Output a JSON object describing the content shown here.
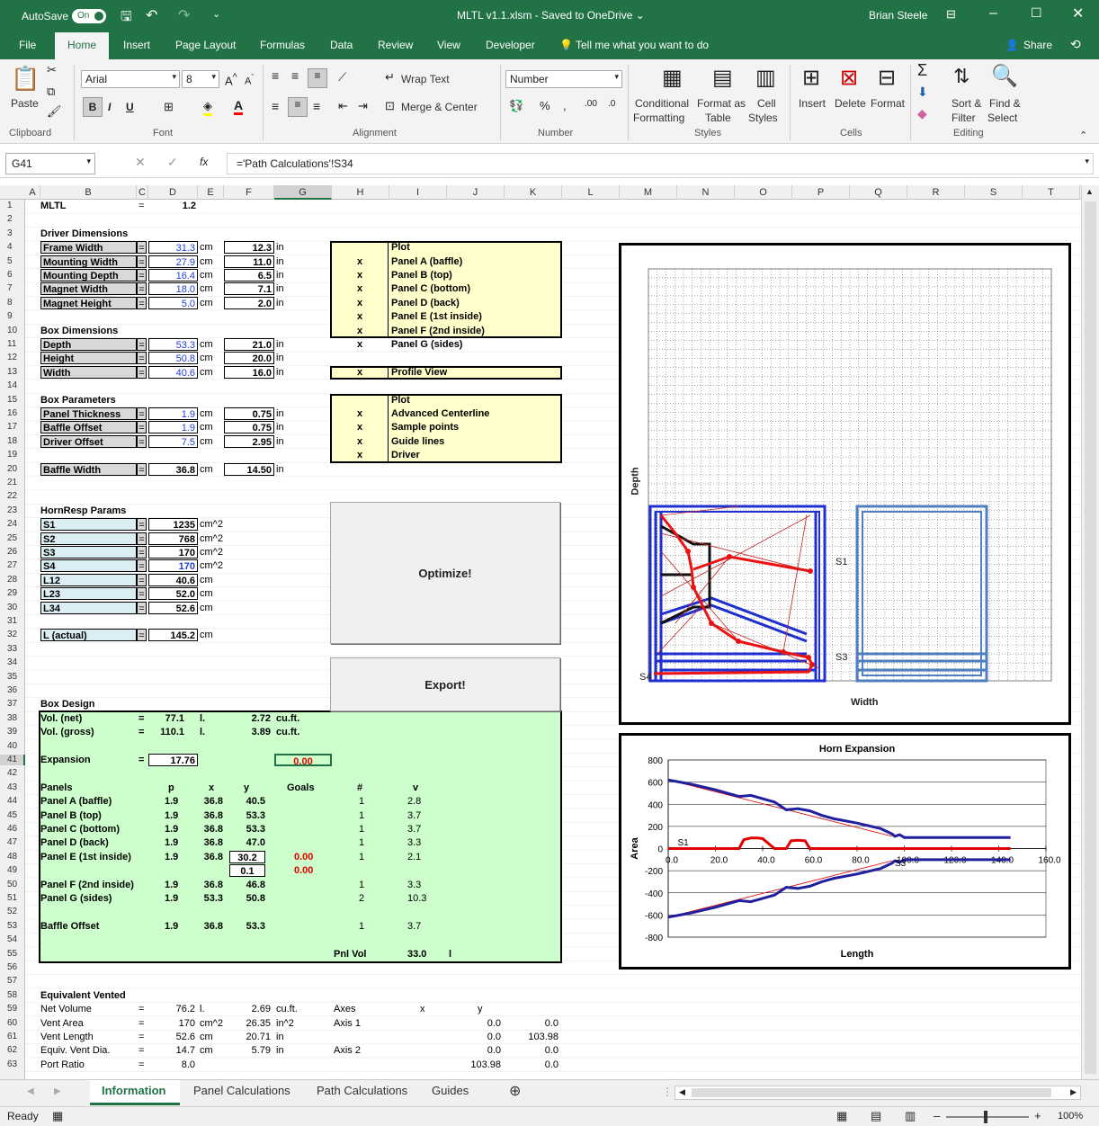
{
  "window": {
    "autosave": "AutoSave",
    "autosave_state": "On",
    "title": "MLTL v1.1.xlsm  -  Saved to OneDrive  ⌄",
    "user": "Brian Steele"
  },
  "ribbon_tabs": [
    "File",
    "Home",
    "Insert",
    "Page Layout",
    "Formulas",
    "Data",
    "Review",
    "View",
    "Developer",
    "Tell me what you want to do",
    "Share"
  ],
  "ribbon": {
    "paste": "Paste",
    "font_name": "Arial",
    "font_size": "8",
    "wrap_text": "Wrap Text",
    "merge_center": "Merge & Center",
    "number_format": "Number",
    "conditional": "Conditional",
    "formatting": "Formatting",
    "format_as": "Format as",
    "table": "Table",
    "cell": "Cell",
    "styles_lbl": "Styles",
    "insert": "Insert",
    "delete": "Delete",
    "format": "Format",
    "sort": "Sort &",
    "filter": "Filter",
    "find": "Find &",
    "select": "Select",
    "groups": [
      "Clipboard",
      "Font",
      "Alignment",
      "Number",
      "Styles",
      "Cells",
      "Editing"
    ]
  },
  "formula_bar": {
    "name_box": "G41",
    "fx": "fx",
    "formula": "='Path Calculations'!S34"
  },
  "columns": [
    "A",
    "B",
    "C",
    "D",
    "E",
    "F",
    "G",
    "H",
    "I",
    "J",
    "K",
    "L",
    "M",
    "N",
    "O",
    "P",
    "Q",
    "R",
    "S",
    "T"
  ],
  "rows": [
    "1",
    "2",
    "3",
    "4",
    "5",
    "6",
    "7",
    "8",
    "9",
    "10",
    "11",
    "12",
    "13",
    "14",
    "15",
    "16",
    "17",
    "18",
    "19",
    "20",
    "21",
    "22",
    "23",
    "24",
    "25",
    "26",
    "27",
    "28",
    "29",
    "30",
    "31",
    "32",
    "33",
    "34",
    "35",
    "36",
    "37",
    "38",
    "39",
    "40",
    "41",
    "42",
    "43",
    "44",
    "45",
    "46",
    "47",
    "48",
    "49",
    "50",
    "51",
    "52",
    "53",
    "54",
    "55",
    "56",
    "57",
    "58",
    "59",
    "60",
    "61",
    "62",
    "63"
  ],
  "sheet": {
    "title": "MLTL",
    "title_eq": "=",
    "version": "1.2",
    "driver_hdr": "Driver Dimensions",
    "driver": [
      {
        "label": "Frame Width",
        "cm": "31.3",
        "in": "12.3"
      },
      {
        "label": "Mounting Width",
        "cm": "27.9",
        "in": "11.0"
      },
      {
        "label": "Mounting Depth",
        "cm": "16.4",
        "in": "6.5"
      },
      {
        "label": "Magnet Width",
        "cm": "18.0",
        "in": "7.1"
      },
      {
        "label": "Magnet Height",
        "cm": "5.0",
        "in": "2.0"
      }
    ],
    "box_hdr": "Box Dimensions",
    "box": [
      {
        "label": "Depth",
        "cm": "53.3",
        "in": "21.0"
      },
      {
        "label": "Height",
        "cm": "50.8",
        "in": "20.0"
      },
      {
        "label": "Width",
        "cm": "40.6",
        "in": "16.0"
      }
    ],
    "params_hdr": "Box Parameters",
    "params": [
      {
        "label": "Panel Thickness",
        "cm": "1.9",
        "in": "0.75"
      },
      {
        "label": "Baffle Offset",
        "cm": "1.9",
        "in": "0.75"
      },
      {
        "label": "Driver Offset",
        "cm": "7.5",
        "in": "2.95"
      }
    ],
    "baffle": {
      "label": "Baffle Width",
      "cm": "36.8",
      "in": "14.50"
    },
    "unit_cm": "cm",
    "unit_in": "in",
    "eq": "=",
    "hornresp_hdr": "HornResp Params",
    "hornresp": [
      {
        "label": "S1",
        "val": "1235",
        "unit": "cm^2"
      },
      {
        "label": "S2",
        "val": "768",
        "unit": "cm^2"
      },
      {
        "label": "S3",
        "val": "170",
        "unit": "cm^2"
      },
      {
        "label": "S4",
        "val": "170",
        "unit": "cm^2"
      },
      {
        "label": "L12",
        "val": "40.6",
        "unit": "cm"
      },
      {
        "label": "L23",
        "val": "52.0",
        "unit": "cm"
      },
      {
        "label": "L34",
        "val": "52.6",
        "unit": "cm"
      }
    ],
    "lactual": {
      "label": "L (actual)",
      "val": "145.2",
      "unit": "cm"
    },
    "plot1": {
      "hdr": "Plot",
      "items": [
        {
          "x": "x",
          "label": "Panel A (baffle)"
        },
        {
          "x": "x",
          "label": "Panel B (top)"
        },
        {
          "x": "x",
          "label": "Panel C (bottom)"
        },
        {
          "x": "x",
          "label": "Panel D (back)"
        },
        {
          "x": "x",
          "label": "Panel E (1st inside)"
        },
        {
          "x": "x",
          "label": "Panel F (2nd inside)"
        },
        {
          "x": "x",
          "label": "Panel G (sides)"
        }
      ]
    },
    "profile": {
      "x": "x",
      "label": "Profile View"
    },
    "plot2": {
      "hdr": "Plot",
      "items": [
        {
          "x": "x",
          "label": "Advanced Centerline"
        },
        {
          "x": "x",
          "label": "Sample points"
        },
        {
          "x": "x",
          "label": "Guide lines"
        },
        {
          "x": "x",
          "label": "Driver"
        }
      ]
    },
    "optimize": "Optimize!",
    "export": "Export!",
    "design_hdr": "Box Design",
    "vol_net": {
      "label": "Vol. (net)",
      "eq": "=",
      "l": "77.1",
      "lu": "l.",
      "cf": "2.72",
      "cfu": "cu.ft."
    },
    "vol_gross": {
      "label": "Vol. (gross)",
      "eq": "=",
      "l": "110.1",
      "lu": "l.",
      "cf": "3.89",
      "cfu": "cu.ft."
    },
    "expansion": {
      "label": "Expansion",
      "eq": "=",
      "val": "17.76",
      "goal": "0.00"
    },
    "panel_cols": {
      "name": "Panels",
      "p": "p",
      "x": "x",
      "y": "y",
      "goals": "Goals",
      "n": "#",
      "v": "v"
    },
    "panels": [
      {
        "name": "Panel A (baffle)",
        "p": "1.9",
        "x": "36.8",
        "y": "40.5",
        "g": "",
        "n": "1",
        "v": "2.8"
      },
      {
        "name": "Panel B (top)",
        "p": "1.9",
        "x": "36.8",
        "y": "53.3",
        "g": "",
        "n": "1",
        "v": "3.7"
      },
      {
        "name": "Panel C (bottom)",
        "p": "1.9",
        "x": "36.8",
        "y": "53.3",
        "g": "",
        "n": "1",
        "v": "3.7"
      },
      {
        "name": "Panel D (back)",
        "p": "1.9",
        "x": "36.8",
        "y": "47.0",
        "g": "",
        "n": "1",
        "v": "3.3"
      },
      {
        "name": "Panel E (1st inside)",
        "p": "1.9",
        "x": "36.8",
        "y": "30.2",
        "g": "0.00",
        "n": "1",
        "v": "2.1"
      }
    ],
    "panel_e2": {
      "y": "0.1",
      "g": "0.00"
    },
    "panels2": [
      {
        "name": "Panel F (2nd inside)",
        "p": "1.9",
        "x": "36.8",
        "y": "46.8",
        "n": "1",
        "v": "3.3"
      },
      {
        "name": "Panel G (sides)",
        "p": "1.9",
        "x": "53.3",
        "y": "50.8",
        "n": "2",
        "v": "10.3"
      }
    ],
    "baffle_offset": {
      "name": "Baffle Offset",
      "p": "1.9",
      "x": "36.8",
      "y": "53.3",
      "n": "1",
      "v": "3.7"
    },
    "pnlvol": {
      "label": "Pnl Vol",
      "val": "33.0",
      "unit": "l"
    },
    "vented_hdr": "Equivalent Vented",
    "vented": [
      {
        "label": "Net Volume",
        "eq": "=",
        "a": "76.2",
        "au": "l.",
        "b": "2.69",
        "bu": "cu.ft."
      },
      {
        "label": "Vent Area",
        "eq": "=",
        "a": "170",
        "au": "cm^2",
        "b": "26.35",
        "bu": "in^2"
      },
      {
        "label": "Vent Length",
        "eq": "=",
        "a": "52.6",
        "au": "cm",
        "b": "20.71",
        "bu": "in"
      },
      {
        "label": "Equiv. Vent Dia.",
        "eq": "=",
        "a": "14.7",
        "au": "cm",
        "b": "5.79",
        "bu": "in"
      },
      {
        "label": "Port Ratio",
        "eq": "=",
        "a": "8.0",
        "au": "",
        "b": "",
        "bu": ""
      }
    ],
    "axes": {
      "hdr": "Axes",
      "x": "x",
      "y": "y",
      "rows": [
        {
          "name": "Axis 1",
          "x": "0.0",
          "y": "0.0"
        },
        {
          "name": "",
          "x": "0.0",
          "y": "103.98"
        },
        {
          "name": "Axis 2",
          "x": "0.0",
          "y": "0.0"
        },
        {
          "name": "",
          "x": "103.98",
          "y": "0.0"
        }
      ]
    }
  },
  "profile_chart": {
    "xlabel": "Width",
    "ylabel": "Depth",
    "s1": "S1",
    "s3": "S3",
    "s4": "S4"
  },
  "chart_data": {
    "type": "line",
    "title": "Horn Expansion",
    "xlabel": "Length",
    "ylabel": "Area",
    "xlim": [
      0,
      160
    ],
    "ylim": [
      -800,
      800
    ],
    "xticks": [
      "0.0",
      "20.0",
      "40.0",
      "60.0",
      "80.0",
      "100.0",
      "120.0",
      "140.0",
      "160.0"
    ],
    "yticks": [
      "800",
      "600",
      "400",
      "200",
      "0",
      "-200",
      "-400",
      "-600",
      "-800"
    ],
    "annotations": [
      "S1",
      "S3"
    ],
    "series": [
      {
        "color": "#1f1fa0",
        "x": [
          0,
          10,
          20,
          30,
          35,
          40,
          45,
          50,
          55,
          60,
          65,
          70,
          80,
          90,
          95,
          96,
          98,
          100,
          110,
          120,
          130,
          145
        ],
        "y": [
          620,
          580,
          530,
          470,
          480,
          450,
          420,
          350,
          360,
          340,
          300,
          270,
          230,
          180,
          130,
          110,
          125,
          100,
          100,
          100,
          100,
          100
        ]
      },
      {
        "color": "#1f1fa0",
        "x": [
          0,
          10,
          20,
          30,
          35,
          40,
          45,
          50,
          55,
          60,
          65,
          70,
          80,
          90,
          95,
          96,
          98,
          100,
          110,
          120,
          130,
          145
        ],
        "y": [
          -620,
          -580,
          -530,
          -470,
          -480,
          -450,
          -420,
          -350,
          -360,
          -340,
          -300,
          -270,
          -230,
          -180,
          -130,
          -110,
          -125,
          -100,
          -100,
          -100,
          -100,
          -100
        ]
      },
      {
        "color": "#e00000",
        "x": [
          0,
          30,
          32,
          35,
          38,
          40,
          45,
          50,
          52,
          55,
          58,
          60,
          62,
          145
        ],
        "y": [
          0,
          0,
          80,
          95,
          95,
          90,
          0,
          0,
          70,
          75,
          70,
          0,
          0,
          0
        ]
      }
    ]
  },
  "sheet_tabs": [
    "Information",
    "Panel Calculations",
    "Path Calculations",
    "Guides"
  ],
  "status": {
    "ready": "Ready",
    "zoom": "100%"
  }
}
